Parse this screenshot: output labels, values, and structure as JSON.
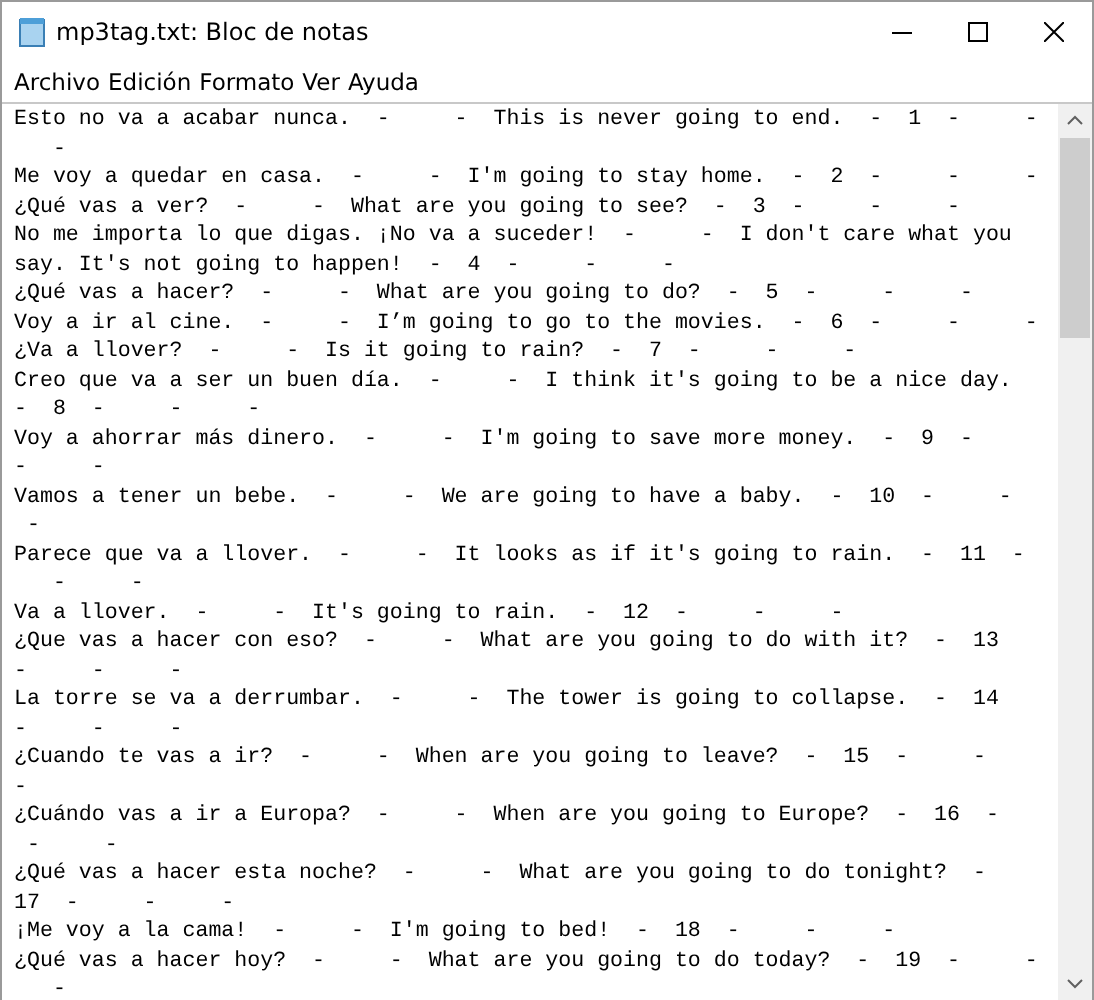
{
  "window": {
    "title": "mp3tag.txt: Bloc de notas"
  },
  "menu": [
    "Archivo",
    "Edición",
    "Formato",
    "Ver",
    "Ayuda"
  ],
  "editor": {
    "lines": [
      "Esto no va a acabar nunca.  -     -  This is never going to end.  -  1  -     -",
      "   -",
      "Me voy a quedar en casa.  -     -  I'm going to stay home.  -  2  -     -     -",
      "¿Qué vas a ver?  -     -  What are you going to see?  -  3  -     -     -",
      "No me importa lo que digas. ¡No va a suceder!  -     -  I don't care what you",
      "say. It's not going to happen!  -  4  -     -     -",
      "¿Qué vas a hacer?  -     -  What are you going to do?  -  5  -     -     -",
      "Voy a ir al cine.  -     -  I’m going to go to the movies.  -  6  -     -     -",
      "¿Va a llover?  -     -  Is it going to rain?  -  7  -     -     -",
      "Creo que va a ser un buen día.  -     -  I think it's going to be a nice day.",
      "-  8  -     -     -",
      "Voy a ahorrar más dinero.  -     -  I'm going to save more money.  -  9  -",
      "-     -",
      "Vamos a tener un bebe.  -     -  We are going to have a baby.  -  10  -     -",
      " -",
      "Parece que va a llover.  -     -  It looks as if it's going to rain.  -  11  -",
      "   -     -",
      "Va a llover.  -     -  It's going to rain.  -  12  -     -     -",
      "¿Que vas a hacer con eso?  -     -  What are you going to do with it?  -  13",
      "-     -     -",
      "La torre se va a derrumbar.  -     -  The tower is going to collapse.  -  14",
      "-     -     -",
      "¿Cuando te vas a ir?  -     -  When are you going to leave?  -  15  -     -",
      "-",
      "¿Cuándo vas a ir a Europa?  -     -  When are you going to Europe?  -  16  -",
      " -     -",
      "¿Qué vas a hacer esta noche?  -     -  What are you going to do tonight?  -",
      "17  -     -     -",
      "¡Me voy a la cama!  -     -  I'm going to bed!  -  18  -     -     -",
      "¿Qué vas a hacer hoy?  -     -  What are you going to do today?  -  19  -     -",
      "   -"
    ]
  }
}
